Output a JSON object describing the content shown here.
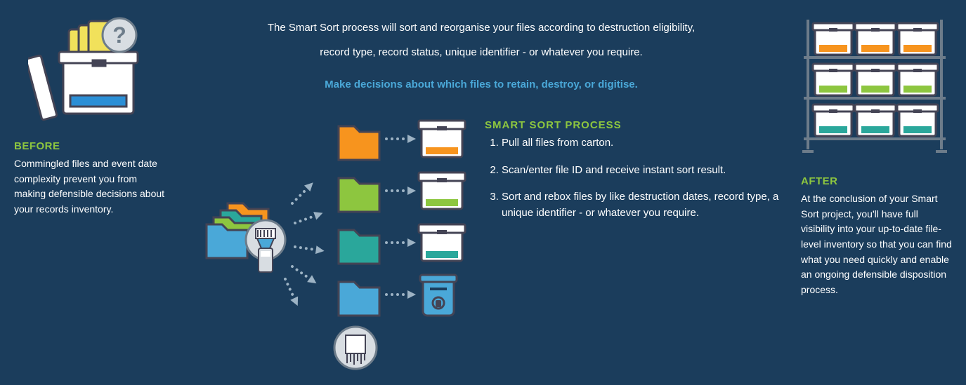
{
  "intro": {
    "line1": "The Smart Sort process will sort and reorganise your files according to destruction eligibility,",
    "line2": "record type, record status, unique identifier - or whatever you require.",
    "tagline": "Make decisions about which files to retain, destroy, or digitise."
  },
  "before": {
    "label": "BEFORE",
    "text": "Commingled files and event date complexity prevent you from making defensible decisions about your records inventory."
  },
  "process": {
    "label": "SMART SORT PROCESS",
    "steps": [
      "Pull all files from carton.",
      "Scan/enter file ID and receive instant sort result.",
      "Sort and rebox files by like destruction dates, record type, a unique identifier - or whatever you require."
    ]
  },
  "after": {
    "label": "AFTER",
    "text": "At the conclusion of your Smart Sort project, you'll have full visibility into your up-to-date file-level inventory so that you can find what you need quickly and enable an ongoing defensible disposition process."
  },
  "icons": {
    "before": "question-box",
    "scanner": "barcode-scanner",
    "folders": [
      "orange",
      "green",
      "teal",
      "lblue"
    ],
    "shred": "shred-document",
    "lockbin": "secure-bin",
    "shelf_rows": [
      "orange",
      "green",
      "teal"
    ]
  }
}
